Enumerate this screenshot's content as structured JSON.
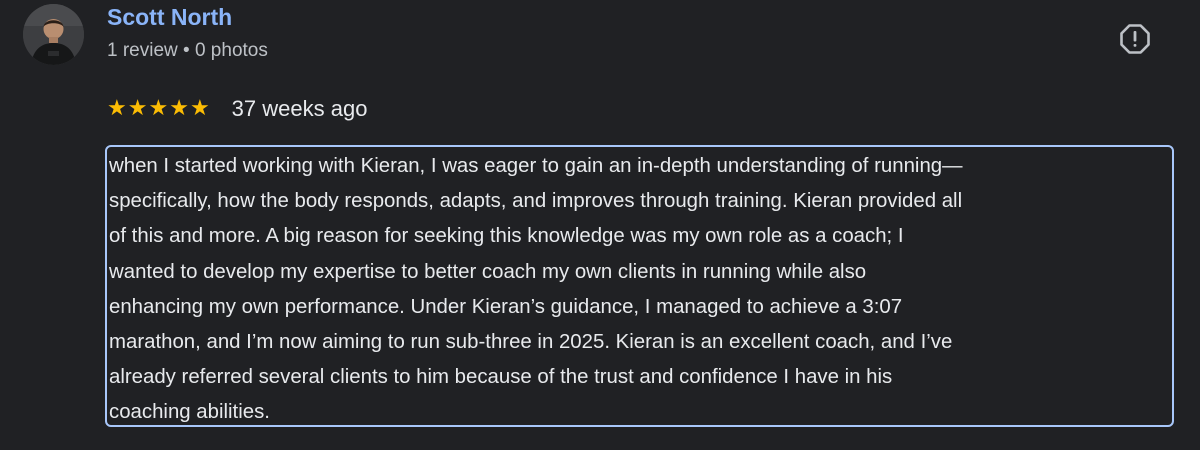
{
  "author": {
    "name": "Scott North",
    "meta": "1 review • 0 photos",
    "avatar_icon": "profile-photo"
  },
  "report": {
    "icon": "report-flag-icon"
  },
  "rating": {
    "stars": 5,
    "max_stars": 5,
    "star_color": "#fbbc04",
    "date": "37 weeks ago"
  },
  "review": {
    "text": "when I started working with Kieran, I was eager to gain an in-depth understanding of running—\nspecifically, how the body responds, adapts, and improves through training. Kieran provided all\nof this and more. A big reason for seeking this knowledge was my own role as a coach; I\nwanted to develop my expertise to better coach my own clients in running while also\nenhancing my own performance. Under Kieran’s guidance, I managed to achieve a 3:07\nmarathon, and I’m now aiming to run sub-three in 2025. Kieran is an excellent coach, and I’ve\nalready referred several clients to him because of the trust and confidence I have in his\ncoaching abilities."
  },
  "colors": {
    "background": "#202124",
    "author_name": "#8ab4f8",
    "text": "#e8eaed",
    "focus_outline": "#a8c7fa"
  }
}
